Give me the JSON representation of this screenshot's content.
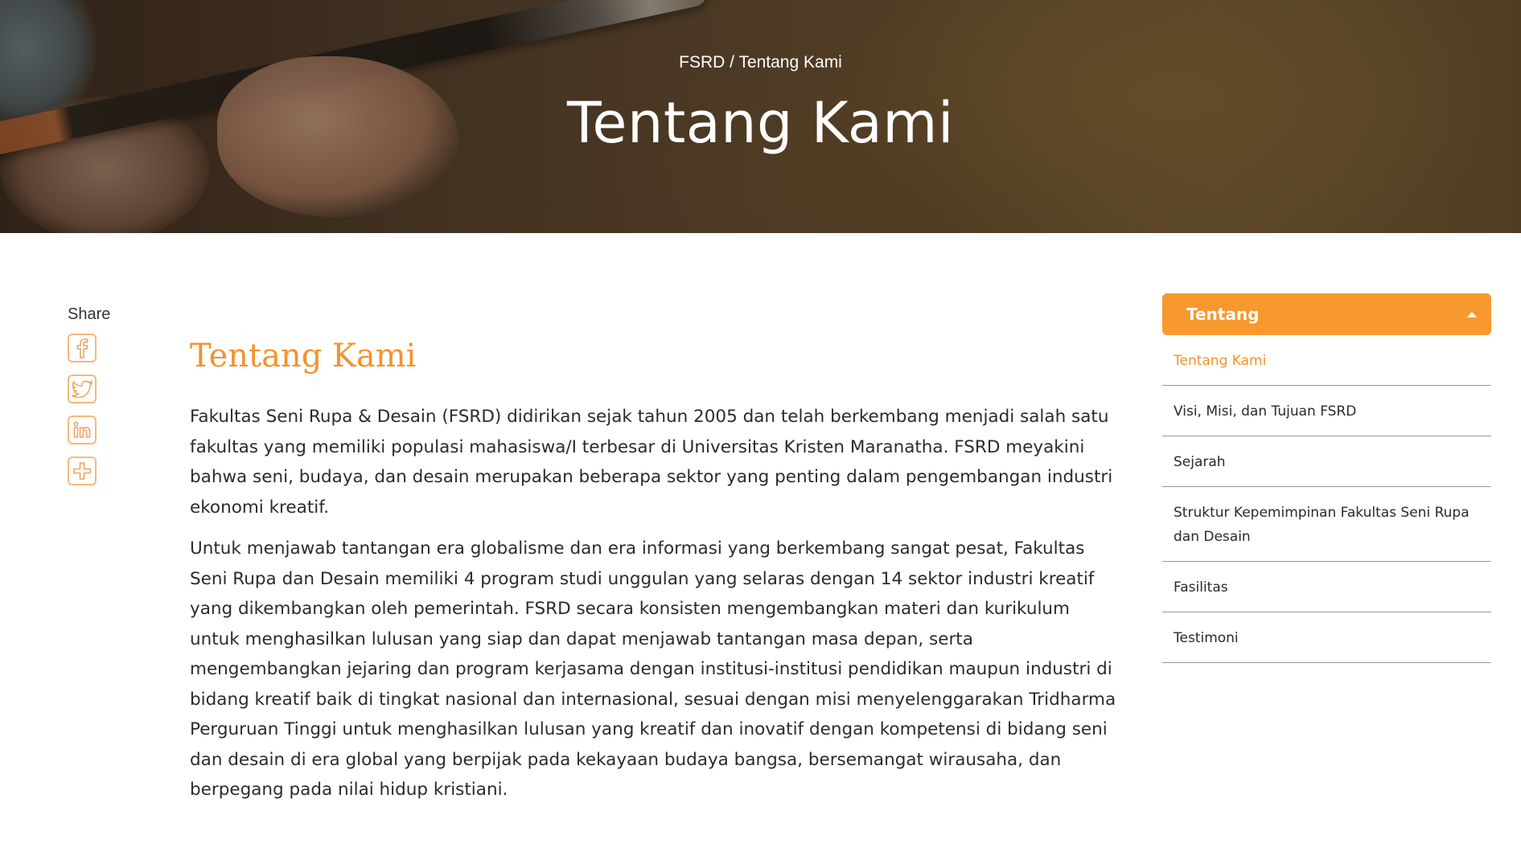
{
  "hero": {
    "breadcrumb": {
      "home": "FSRD",
      "separator": " / ",
      "current": "Tentang Kami"
    },
    "title": "Tentang Kami"
  },
  "share": {
    "label": "Share",
    "buttons": [
      {
        "icon": "facebook-icon",
        "glyph": "f"
      },
      {
        "icon": "twitter-icon",
        "glyph": "t"
      },
      {
        "icon": "linkedin-icon",
        "glyph": "in"
      },
      {
        "icon": "plus-icon",
        "glyph": "+"
      }
    ]
  },
  "article": {
    "heading": "Tentang Kami",
    "paragraphs": [
      "Fakultas Seni Rupa & Desain (FSRD) didirikan sejak tahun 2005 dan telah berkembang menjadi salah satu fakultas yang memiliki populasi mahasiswa/I terbesar di Universitas Kristen Maranatha. FSRD meyakini bahwa seni, budaya, dan desain merupakan beberapa sektor yang penting dalam pengembangan industri ekonomi kreatif.",
      "Untuk menjawab tantangan era globalisme dan era informasi yang berkembang sangat pesat, Fakultas Seni Rupa dan Desain memiliki 4 program studi unggulan yang selaras dengan 14 sektor industri kreatif yang dikembangkan oleh pemerintah. FSRD secara konsisten mengembangkan materi dan kurikulum untuk menghasilkan lulusan yang siap dan dapat menjawab tantangan masa depan, serta  mengembangkan jejaring dan program kerjasama dengan institusi-institusi pendidikan maupun industri di bidang kreatif baik di tingkat nasional dan internasional, sesuai dengan misi menyelenggarakan Tridharma Perguruan Tinggi untuk menghasilkan lulusan yang kreatif dan inovatif dengan kompetensi di bidang seni dan desain di era global yang berpijak pada kekayaan budaya bangsa, bersemangat wirausaha, dan berpegang pada nilai hidup kristiani."
    ]
  },
  "sidebar": {
    "header": "Tentang",
    "items": [
      {
        "label": "Tentang Kami",
        "active": true
      },
      {
        "label": "Visi, Misi, dan Tujuan FSRD",
        "active": false
      },
      {
        "label": "Sejarah",
        "active": false
      },
      {
        "label": "Struktur Kepemimpinan Fakultas Seni Rupa dan Desain",
        "active": false
      },
      {
        "label": "Fasilitas",
        "active": false
      },
      {
        "label": "Testimoni",
        "active": false
      }
    ]
  },
  "colors": {
    "accent": "#f7992f",
    "heading": "#f4922d",
    "share_border": "#f7b87a"
  }
}
